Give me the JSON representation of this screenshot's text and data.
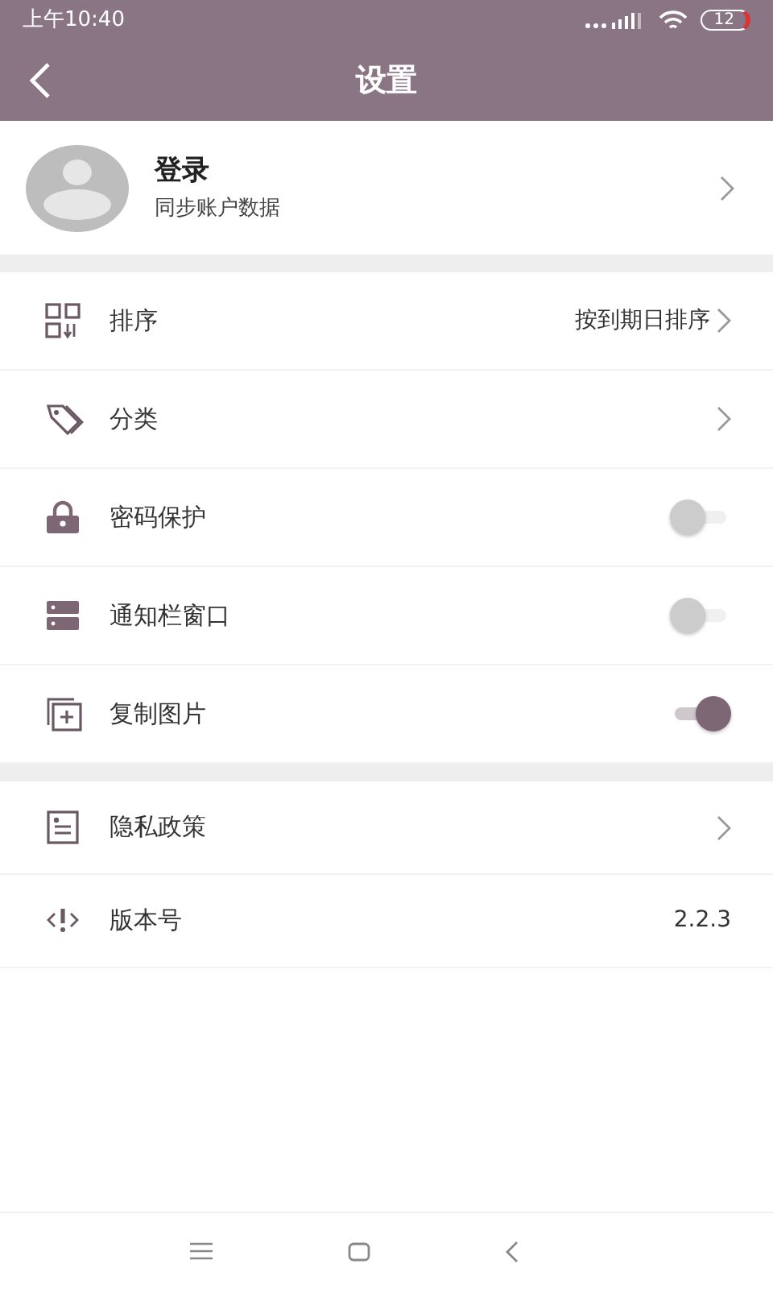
{
  "status_bar": {
    "time": "上午10:40",
    "battery": "12"
  },
  "header": {
    "title": "设置"
  },
  "profile": {
    "name": "登录",
    "subtitle": "同步账户数据"
  },
  "groups": [
    [
      {
        "kind": "link",
        "label": "排序",
        "value": "按到期日排序"
      },
      {
        "kind": "link",
        "label": "分类"
      },
      {
        "kind": "toggle",
        "label": "密码保护",
        "on": false
      },
      {
        "kind": "toggle",
        "label": "通知栏窗口",
        "on": false
      },
      {
        "kind": "toggle",
        "label": "复制图片",
        "on": true
      }
    ],
    [
      {
        "kind": "link",
        "label": "隐私政策"
      },
      {
        "kind": "info",
        "label": "版本号",
        "value": "2.2.3"
      }
    ]
  ]
}
